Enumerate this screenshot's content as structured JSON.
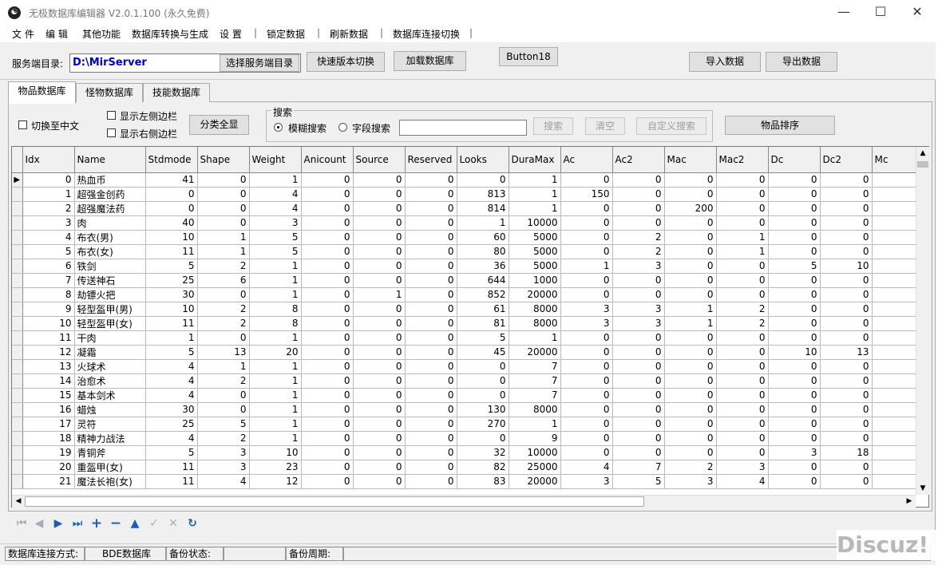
{
  "window": {
    "title": "无极数据库编辑器 V2.0.1.100 (永久免费)",
    "app_icon": "☯",
    "minimize": "—",
    "maximize": "☐",
    "close": "✕"
  },
  "menu": {
    "items": [
      "文 件",
      "编 辑",
      "其他功能",
      "数据库转换与生成",
      "设 置",
      "锁定数据",
      "刷新数据",
      "数据库连接切换"
    ],
    "separator": "|"
  },
  "toolbar": {
    "server_dir_label": "服务端目录:",
    "server_dir_value": "D:\\MirServer",
    "select_dir_button": "选择服务端目录",
    "quick_version_button": "快速版本切换",
    "load_db_button": "加载数据库",
    "button18": "Button18",
    "import_button": "导入数据",
    "export_button": "导出数据"
  },
  "tabs": [
    "物品数据库",
    "怪物数据库",
    "技能数据库"
  ],
  "options": {
    "chinese_toggle": "切换至中文",
    "show_left_sidebar": "显示左侧边栏",
    "show_right_sidebar": "显示右侧边栏",
    "show_all_button": "分类全显",
    "search_group": "搜索",
    "fuzzy_search": "模糊搜索",
    "field_search": "字段搜索",
    "search_value": "",
    "search_button": "搜索",
    "clear_button": "清空",
    "custom_search_button": "自定义搜索",
    "sort_items_button": "物品排序"
  },
  "grid": {
    "row_indicator": "▶",
    "columns": [
      "Idx",
      "Name",
      "Stdmode",
      "Shape",
      "Weight",
      "Anicount",
      "Source",
      "Reserved",
      "Looks",
      "DuraMax",
      "Ac",
      "Ac2",
      "Mac",
      "Mac2",
      "Dc",
      "Dc2",
      "Mc"
    ],
    "rows": [
      [
        "0",
        "热血币",
        "41",
        "0",
        "1",
        "0",
        "0",
        "0",
        "0",
        "1",
        "0",
        "0",
        "0",
        "0",
        "0",
        "0",
        ""
      ],
      [
        "1",
        "超强金创药",
        "0",
        "0",
        "4",
        "0",
        "0",
        "0",
        "813",
        "1",
        "150",
        "0",
        "0",
        "0",
        "0",
        "0",
        ""
      ],
      [
        "2",
        "超强魔法药",
        "0",
        "0",
        "4",
        "0",
        "0",
        "0",
        "814",
        "1",
        "0",
        "0",
        "200",
        "0",
        "0",
        "0",
        ""
      ],
      [
        "3",
        "肉",
        "40",
        "0",
        "3",
        "0",
        "0",
        "0",
        "1",
        "10000",
        "0",
        "0",
        "0",
        "0",
        "0",
        "0",
        ""
      ],
      [
        "4",
        "布衣(男)",
        "10",
        "1",
        "5",
        "0",
        "0",
        "0",
        "60",
        "5000",
        "0",
        "2",
        "0",
        "1",
        "0",
        "0",
        ""
      ],
      [
        "5",
        "布衣(女)",
        "11",
        "1",
        "5",
        "0",
        "0",
        "0",
        "80",
        "5000",
        "0",
        "2",
        "0",
        "1",
        "0",
        "0",
        ""
      ],
      [
        "6",
        "铁剑",
        "5",
        "2",
        "1",
        "0",
        "0",
        "0",
        "36",
        "5000",
        "1",
        "3",
        "0",
        "0",
        "5",
        "10",
        ""
      ],
      [
        "7",
        "传送神石",
        "25",
        "6",
        "1",
        "0",
        "0",
        "0",
        "644",
        "1000",
        "0",
        "0",
        "0",
        "0",
        "0",
        "0",
        ""
      ],
      [
        "8",
        "劫镖火把",
        "30",
        "0",
        "1",
        "0",
        "1",
        "0",
        "852",
        "20000",
        "0",
        "0",
        "0",
        "0",
        "0",
        "0",
        ""
      ],
      [
        "9",
        "轻型盔甲(男)",
        "10",
        "2",
        "8",
        "0",
        "0",
        "0",
        "61",
        "8000",
        "3",
        "3",
        "1",
        "2",
        "0",
        "0",
        ""
      ],
      [
        "10",
        "轻型盔甲(女)",
        "11",
        "2",
        "8",
        "0",
        "0",
        "0",
        "81",
        "8000",
        "3",
        "3",
        "1",
        "2",
        "0",
        "0",
        ""
      ],
      [
        "11",
        "干肉",
        "1",
        "0",
        "1",
        "0",
        "0",
        "0",
        "5",
        "1",
        "0",
        "0",
        "0",
        "0",
        "0",
        "0",
        ""
      ],
      [
        "12",
        "凝霜",
        "5",
        "13",
        "20",
        "0",
        "0",
        "0",
        "45",
        "20000",
        "0",
        "0",
        "0",
        "0",
        "10",
        "13",
        ""
      ],
      [
        "13",
        "火球术",
        "4",
        "1",
        "1",
        "0",
        "0",
        "0",
        "0",
        "7",
        "0",
        "0",
        "0",
        "0",
        "0",
        "0",
        ""
      ],
      [
        "14",
        "治愈术",
        "4",
        "2",
        "1",
        "0",
        "0",
        "0",
        "0",
        "7",
        "0",
        "0",
        "0",
        "0",
        "0",
        "0",
        ""
      ],
      [
        "15",
        "基本剑术",
        "4",
        "0",
        "1",
        "0",
        "0",
        "0",
        "0",
        "7",
        "0",
        "0",
        "0",
        "0",
        "0",
        "0",
        ""
      ],
      [
        "16",
        "蜡烛",
        "30",
        "0",
        "1",
        "0",
        "0",
        "0",
        "130",
        "8000",
        "0",
        "0",
        "0",
        "0",
        "0",
        "0",
        ""
      ],
      [
        "17",
        "灵符",
        "25",
        "5",
        "1",
        "0",
        "0",
        "0",
        "270",
        "1",
        "0",
        "0",
        "0",
        "0",
        "0",
        "0",
        ""
      ],
      [
        "18",
        "精神力战法",
        "4",
        "2",
        "1",
        "0",
        "0",
        "0",
        "0",
        "9",
        "0",
        "0",
        "0",
        "0",
        "0",
        "0",
        ""
      ],
      [
        "19",
        "青铜斧",
        "5",
        "3",
        "10",
        "0",
        "0",
        "0",
        "32",
        "10000",
        "0",
        "0",
        "0",
        "0",
        "3",
        "18",
        ""
      ],
      [
        "20",
        "重盔甲(女)",
        "11",
        "3",
        "23",
        "0",
        "0",
        "0",
        "82",
        "25000",
        "4",
        "7",
        "2",
        "3",
        "0",
        "0",
        ""
      ],
      [
        "21",
        "魔法长袍(女)",
        "11",
        "4",
        "12",
        "0",
        "0",
        "0",
        "83",
        "20000",
        "3",
        "5",
        "3",
        "4",
        "0",
        "0",
        ""
      ]
    ]
  },
  "scrollbars": {
    "up": "▲",
    "down": "▼",
    "left": "◀",
    "right": "▶"
  },
  "navigator": {
    "first": "⏮",
    "prior": "◀",
    "next": "▶",
    "last": "⏭",
    "insert": "+",
    "delete": "−",
    "edit": "▲",
    "post": "✓",
    "cancel": "✕",
    "refresh": "↻"
  },
  "status": {
    "conn_label": "数据库连接方式:",
    "conn_value": "BDE数据库",
    "backup_state_label": "备份状态:",
    "backup_state_value": "",
    "backup_cycle_label": "备份周期:",
    "backup_cycle_value": ""
  },
  "watermark": "Discuz!",
  "colors": {
    "path_text": "#0000cc",
    "nav_blue": "#1a5fb4"
  }
}
